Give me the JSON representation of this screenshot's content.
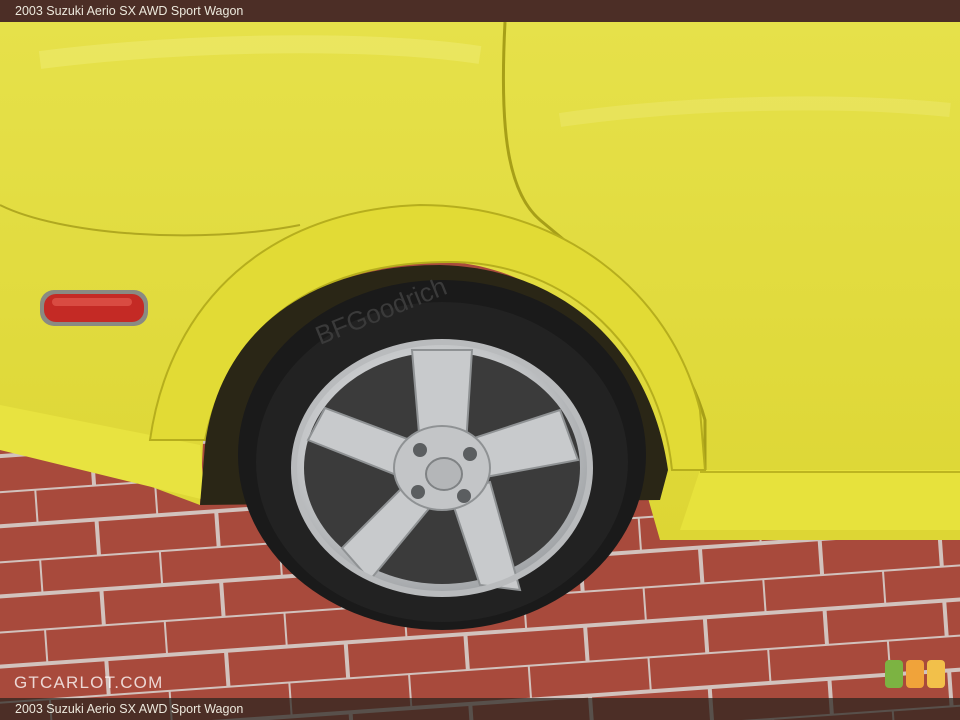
{
  "caption": {
    "top": "2003 Suzuki Aerio SX AWD Sport Wagon",
    "bottom": "2003 Suzuki Aerio SX AWD Sport Wagon"
  },
  "watermark": {
    "text": "GTCARLOT.COM"
  },
  "tire": {
    "sidewall_brand": "BFGoodrich"
  },
  "colors": {
    "car_body": "#e3dd3a",
    "brick": "#a84a3c",
    "mortar": "#d6c7c2",
    "rim": "#c9cbcc",
    "tire": "#1a1a1a",
    "marker_light": "#c42a25",
    "badge_green": "#7cb342",
    "badge_orange": "#f0a33a",
    "badge_yellow": "#f2c04a"
  }
}
